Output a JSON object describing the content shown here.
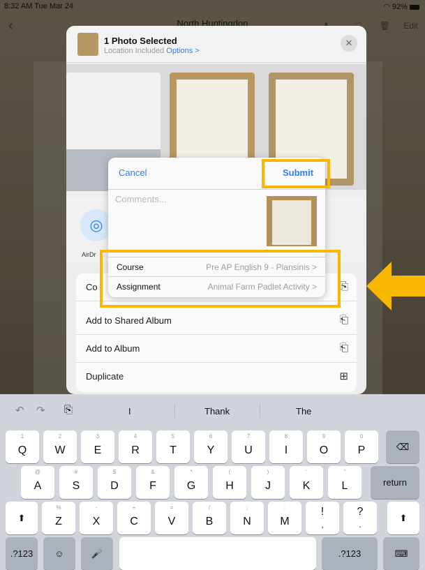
{
  "status_bar": {
    "time": "8:32 AM  Tue Mar 24",
    "battery": "92%"
  },
  "background": {
    "title": "North Huntingdon",
    "edit_label": "Edit"
  },
  "share_sheet": {
    "title": "1 Photo Selected",
    "subtitle": "Location Included",
    "options_label": "Options >",
    "airdrop_label": "AirDr",
    "actions": [
      {
        "label": "Co",
        "icon": "copy-icon"
      },
      {
        "label": "Add to Shared Album",
        "icon": "shared-album-icon"
      },
      {
        "label": "Add to Album",
        "icon": "add-album-icon"
      },
      {
        "label": "Duplicate",
        "icon": "duplicate-icon"
      }
    ]
  },
  "modal": {
    "cancel_label": "Cancel",
    "submit_label": "Submit",
    "comments_placeholder": "Comments...",
    "rows": [
      {
        "label": "Course",
        "value": "Pre AP English 9 - Plansinis >"
      },
      {
        "label": "Assignment",
        "value": "Animal Farm Padlet Activity >"
      }
    ]
  },
  "keyboard": {
    "suggestions": [
      "I",
      "Thank",
      "The"
    ],
    "row1": [
      [
        "1",
        "Q"
      ],
      [
        "2",
        "W"
      ],
      [
        "3",
        "E"
      ],
      [
        "4",
        "R"
      ],
      [
        "5",
        "T"
      ],
      [
        "6",
        "Y"
      ],
      [
        "7",
        "U"
      ],
      [
        "8",
        "I"
      ],
      [
        "9",
        "O"
      ],
      [
        "0",
        "P"
      ]
    ],
    "row2": [
      [
        "@",
        "A"
      ],
      [
        "#",
        "S"
      ],
      [
        "$",
        "D"
      ],
      [
        "&",
        "F"
      ],
      [
        "*",
        "G"
      ],
      [
        "(",
        "H"
      ],
      [
        ")",
        "J"
      ],
      [
        "'",
        "K"
      ],
      [
        "\"",
        "L"
      ]
    ],
    "row3": [
      [
        "%",
        "Z"
      ],
      [
        "-",
        "X"
      ],
      [
        "+",
        "C"
      ],
      [
        "=",
        "V"
      ],
      [
        "/",
        "B"
      ],
      [
        ";",
        "N"
      ],
      [
        ":",
        "M"
      ],
      [
        "",
        "!"
      ],
      [
        "",
        "?"
      ]
    ],
    "row3_punct": [
      ",",
      "."
    ],
    "return_label": "return",
    "numbers_label": ".?123",
    "colors": {
      "highlight": "#F9B800",
      "link": "#2F7CF6"
    }
  }
}
